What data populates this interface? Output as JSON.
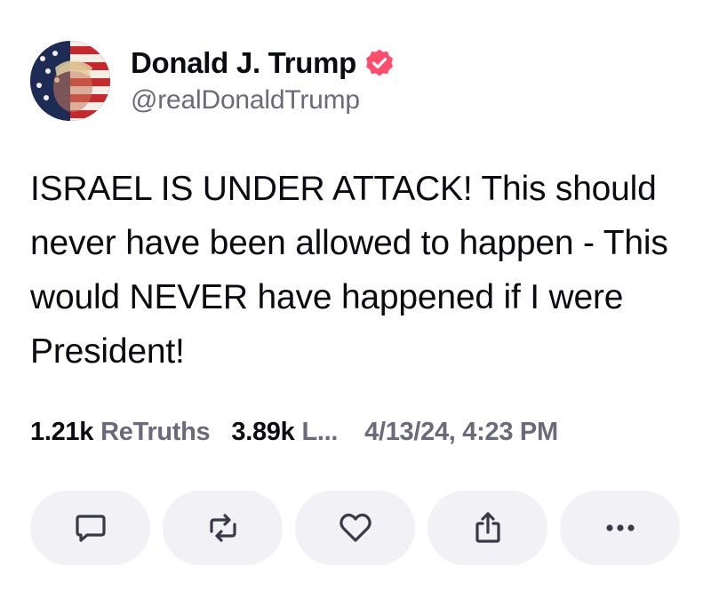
{
  "author": {
    "display_name": "Donald J. Trump",
    "handle": "@realDonaldTrump",
    "verified_color": "#ff4d6d"
  },
  "post": {
    "text": "ISRAEL IS UNDER ATTACK! This should never have been allowed to happen - This would NEVER have happened if I were President!"
  },
  "stats": {
    "retruths_count": "1.21k",
    "retruths_label": "ReTruths",
    "likes_count": "3.89k",
    "likes_label": "L...",
    "timestamp": "4/13/24, 4:23 PM"
  },
  "actions": [
    {
      "icon": "comment-icon"
    },
    {
      "icon": "retruth-icon"
    },
    {
      "icon": "heart-icon"
    },
    {
      "icon": "share-icon"
    },
    {
      "icon": "more-icon"
    }
  ],
  "colors": {
    "text_primary": "#0b0b12",
    "text_secondary": "#6b6a7a",
    "button_bg": "#f2f1f6",
    "icon": "#3a3a46"
  }
}
